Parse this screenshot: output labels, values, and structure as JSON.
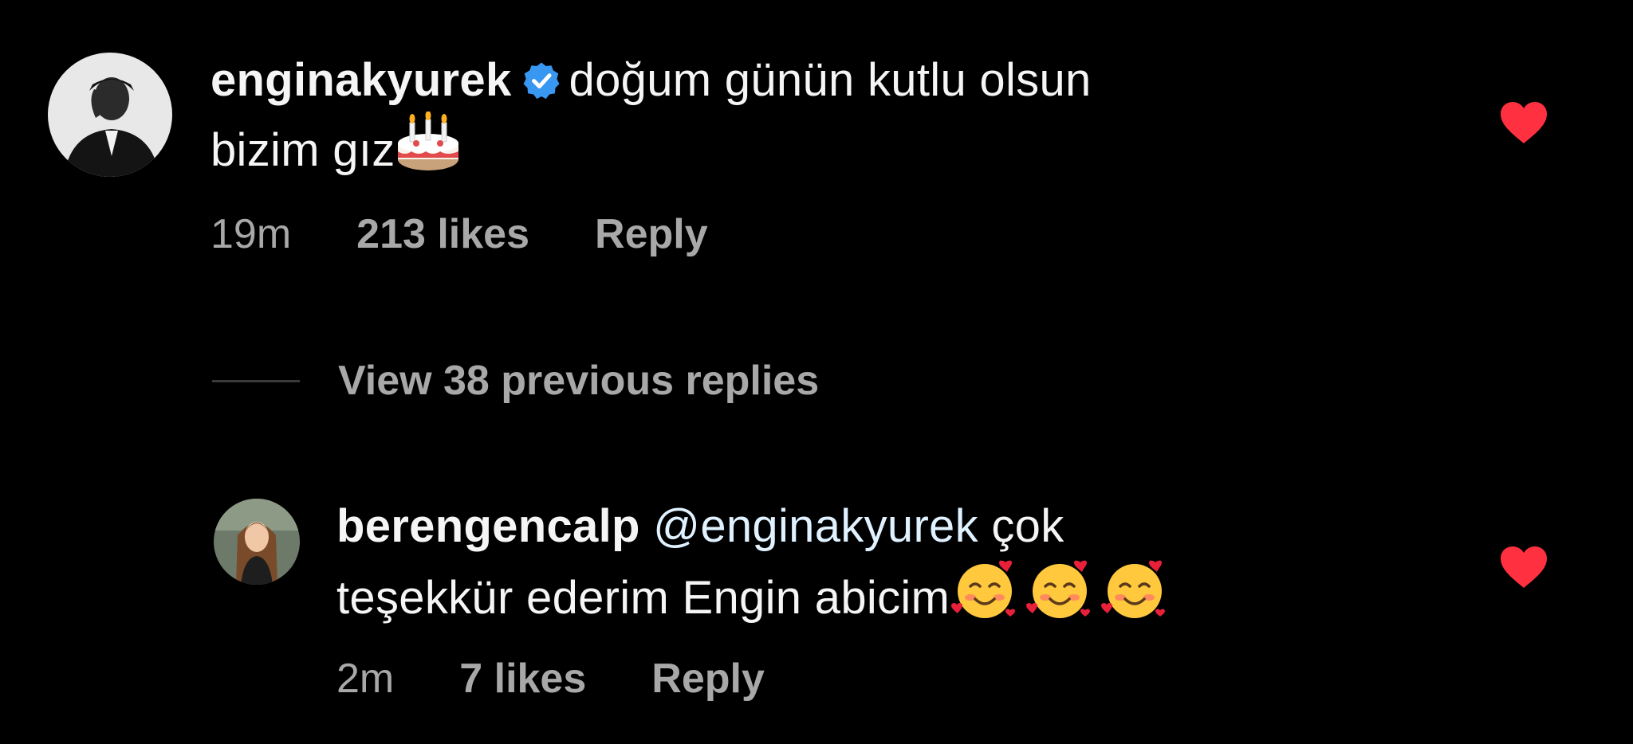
{
  "comments": [
    {
      "username": "enginakyurek",
      "verified": true,
      "text_line1": "doğum günün kutlu olsun",
      "text_line2": "bizim gız",
      "emoji": "birthday-cake",
      "time": "19m",
      "likes": "213 likes",
      "reply": "Reply",
      "liked": true
    },
    {
      "username": "berengencalp",
      "mention": "@enginakyurek",
      "text_line1_rest": "çok",
      "text_line2": "teşekkür ederim Engin abicim",
      "emoji": "smiling-face-with-hearts",
      "time": "2m",
      "likes": "7 likes",
      "reply": "Reply",
      "liked": true
    }
  ],
  "view_replies": {
    "label": "View 38 previous replies"
  },
  "colors": {
    "background": "#000000",
    "text": "#f5f5f5",
    "meta": "#a8a8a8",
    "mention": "#e0f1ff",
    "heart": "#ff3040",
    "verified": "#3897f0"
  }
}
